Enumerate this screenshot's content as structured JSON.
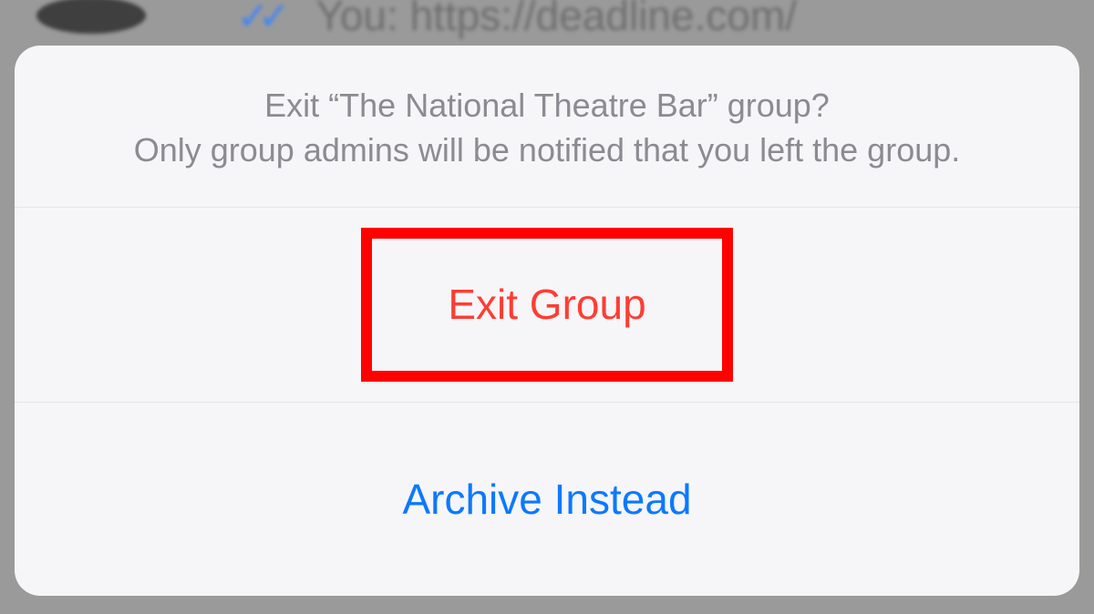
{
  "background": {
    "message_preview": "You: https://deadline.com/"
  },
  "dialog": {
    "title_line1": "Exit “The National Theatre Bar” group?",
    "title_line2": "Only group admins will be notified that you left the group.",
    "exit_label": "Exit Group",
    "archive_label": "Archive Instead"
  },
  "colors": {
    "destructive": "#ff3d33",
    "primary": "#0b79ff",
    "sheet_bg": "#f6f6f8",
    "muted_text": "#8b8b91",
    "highlight": "#ff0000"
  }
}
